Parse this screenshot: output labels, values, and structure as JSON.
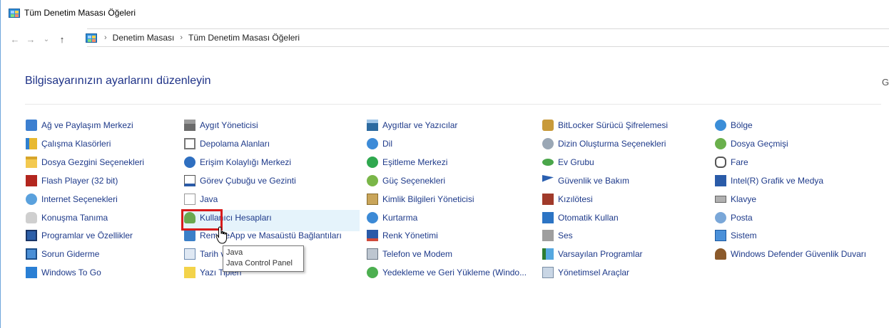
{
  "window": {
    "title": "Tüm Denetim Masası Öğeleri"
  },
  "nav": {
    "back": "←",
    "forward": "→",
    "recent": "⌄",
    "up": "↑"
  },
  "breadcrumb": [
    {
      "label": "Denetim Masası"
    },
    {
      "label": "Tüm Denetim Masası Öğeleri"
    }
  ],
  "heading": "Bilgisayarınızın ayarlarını düzenleyin",
  "view_by_partial": "G",
  "columns": [
    [
      {
        "label": "Ağ ve Paylaşım Merkezi",
        "icon": "network-icon"
      },
      {
        "label": "Çalışma Klasörleri",
        "icon": "work-folders-icon"
      },
      {
        "label": "Dosya Gezgini Seçenekleri",
        "icon": "folder-options-icon"
      },
      {
        "label": "Flash Player (32 bit)",
        "icon": "flash-icon"
      },
      {
        "label": "Internet Seçenekleri",
        "icon": "internet-options-icon"
      },
      {
        "label": "Konuşma Tanıma",
        "icon": "microphone-icon"
      },
      {
        "label": "Programlar ve Özellikler",
        "icon": "programs-icon"
      },
      {
        "label": "Sorun Giderme",
        "icon": "troubleshoot-icon"
      },
      {
        "label": "Windows To Go",
        "icon": "windows-to-go-icon"
      }
    ],
    [
      {
        "label": "Aygıt Yöneticisi",
        "icon": "device-manager-icon"
      },
      {
        "label": "Depolama Alanları",
        "icon": "storage-icon"
      },
      {
        "label": "Erişim Kolaylığı Merkezi",
        "icon": "ease-of-access-icon"
      },
      {
        "label": "Görev Çubuğu ve Gezinti",
        "icon": "taskbar-icon"
      },
      {
        "label": "Java",
        "icon": "java-icon"
      },
      {
        "label": "Kullanıcı Hesapları",
        "icon": "user-accounts-icon"
      },
      {
        "label": "RemoteApp ve Masaüstü Bağlantıları",
        "icon": "remoteapp-icon"
      },
      {
        "label": "Tarih ve Saat",
        "icon": "clock-icon"
      },
      {
        "label": "Yazı Tipleri",
        "icon": "fonts-icon"
      }
    ],
    [
      {
        "label": "Aygıtlar ve Yazıcılar",
        "icon": "printer-icon"
      },
      {
        "label": "Dil",
        "icon": "language-icon"
      },
      {
        "label": "Eşitleme Merkezi",
        "icon": "sync-icon"
      },
      {
        "label": "Güç Seçenekleri",
        "icon": "power-icon"
      },
      {
        "label": "Kimlik Bilgileri Yöneticisi",
        "icon": "credentials-icon"
      },
      {
        "label": "Kurtarma",
        "icon": "recovery-icon"
      },
      {
        "label": "Renk Yönetimi",
        "icon": "color-management-icon"
      },
      {
        "label": "Telefon ve Modem",
        "icon": "phone-modem-icon"
      },
      {
        "label": "Yedekleme ve Geri Yükleme (Windo...",
        "icon": "backup-icon"
      }
    ],
    [
      {
        "label": "BitLocker Sürücü Şifrelemesi",
        "icon": "bitlocker-icon"
      },
      {
        "label": "Dizin Oluşturma Seçenekleri",
        "icon": "indexing-icon"
      },
      {
        "label": "Ev Grubu",
        "icon": "homegroup-icon"
      },
      {
        "label": "Güvenlik ve Bakım",
        "icon": "flag-icon"
      },
      {
        "label": "Kızılötesi",
        "icon": "infrared-icon"
      },
      {
        "label": "Otomatik Kullan",
        "icon": "autoplay-icon"
      },
      {
        "label": "Ses",
        "icon": "speaker-icon"
      },
      {
        "label": "Varsayılan Programlar",
        "icon": "default-programs-icon"
      },
      {
        "label": "Yönetimsel Araçlar",
        "icon": "admin-tools-icon"
      }
    ],
    [
      {
        "label": "Bölge",
        "icon": "region-icon"
      },
      {
        "label": "Dosya Geçmişi",
        "icon": "file-history-icon"
      },
      {
        "label": "Fare",
        "icon": "mouse-icon"
      },
      {
        "label": "Intel(R) Grafik ve Medya",
        "icon": "intel-graphics-icon"
      },
      {
        "label": "Klavye",
        "icon": "keyboard-icon"
      },
      {
        "label": "Posta",
        "icon": "mail-icon"
      },
      {
        "label": "Sistem",
        "icon": "system-icon"
      },
      {
        "label": "Windows Defender Güvenlik Duvarı",
        "icon": "firewall-icon"
      }
    ]
  ],
  "tooltip": {
    "title": "Java",
    "description": "Java Control Panel"
  },
  "colors": {
    "link": "#1e3a8a",
    "heading": "#1e3287",
    "hover": "#e5f3fb",
    "highlight_border": "#d81b1b"
  }
}
